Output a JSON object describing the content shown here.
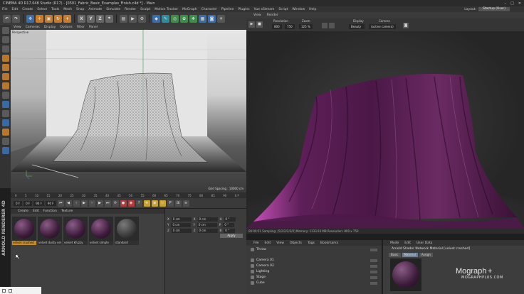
{
  "window": {
    "title": "CINEMA 4D R17.048 Studio (R17) - [0501_Fabric_Basic_Examples_Finish.c4d *] - Main",
    "controls": [
      "–",
      "□",
      "✕"
    ]
  },
  "menubar": {
    "items": [
      "File",
      "Edit",
      "Create",
      "Select",
      "Tools",
      "Mesh",
      "Snap",
      "Animate",
      "Simulate",
      "Render",
      "Sculpt",
      "Motion Tracker",
      "MoGraph",
      "Character",
      "Pipeline",
      "Plugins",
      "Vue xStream",
      "Script",
      "Window",
      "Help"
    ],
    "layout_label": "Layout:",
    "layout_value": "Startup (User)"
  },
  "toolbar": {
    "axis_x": "X",
    "axis_y": "Y",
    "axis_z": "Z"
  },
  "viewport": {
    "menu": [
      "View",
      "Cameras",
      "Display",
      "Options",
      "Filter",
      "Panel"
    ],
    "label": "Perspective",
    "grid_spacing": "Grid Spacing : 10000 cm"
  },
  "timeline": {
    "ticks": [
      "0",
      "5",
      "10",
      "15",
      "20",
      "25",
      "30",
      "35",
      "40",
      "45",
      "50",
      "55",
      "60",
      "65",
      "70",
      "75",
      "80",
      "85",
      "90"
    ],
    "frame_end": "0 F"
  },
  "transport": {
    "start": "0 F",
    "current": "0 F",
    "end": "90 F",
    "end2": "90 F"
  },
  "material_manager": {
    "menu": [
      "Create",
      "Edit",
      "Function",
      "Texture"
    ],
    "materials": [
      {
        "name": "velvet crushed",
        "selected": true,
        "kind": "purple"
      },
      {
        "name": "velvet dusty vel",
        "selected": false,
        "kind": "purple"
      },
      {
        "name": "velvet kfuzzy",
        "selected": false,
        "kind": "purple"
      },
      {
        "name": "velvet simple",
        "selected": false,
        "kind": "purple"
      },
      {
        "name": "standard",
        "selected": false,
        "kind": "gray"
      }
    ]
  },
  "coordinates": {
    "rows": [
      {
        "a": "X",
        "v1": "0 cm",
        "b": "X",
        "v2": "0 cm",
        "c": "H",
        "v3": "0 °"
      },
      {
        "a": "Y",
        "v1": "0 cm",
        "b": "Y",
        "v2": "0 cm",
        "c": "P",
        "v3": "0 °"
      },
      {
        "a": "Z",
        "v1": "0 cm",
        "b": "Z",
        "v2": "0 cm",
        "c": "B",
        "v3": "0 °"
      }
    ],
    "apply": "Apply"
  },
  "render_view": {
    "menu": [
      "View",
      "Render"
    ],
    "resolution_label": "Resolution",
    "resolution_w": "800",
    "resolution_h": "750",
    "zoom_label": "Zoom",
    "zoom_value": "125 %",
    "display_label": "Display",
    "display_value": "Beauty",
    "camera_label": "Camera",
    "camera_value": "(active camera)",
    "status": "00:00:51  Sampling: [5/2/2/2/3/0]  Memory: 1133.93 MB  Resolution: 800 x 750"
  },
  "object_manager": {
    "menu": [
      "File",
      "Edit",
      "View",
      "Objects",
      "Tags",
      "Bookmarks"
    ],
    "objects": [
      "Throw",
      "Camera 01",
      "Camera 02",
      "Lighting",
      "Stage",
      "Cube"
    ]
  },
  "attribute_manager": {
    "menu": [
      "Mode",
      "Edit",
      "User Data"
    ],
    "title": "Arnold Shader Network Material [velvet crushed]",
    "tabs": [
      "Basic",
      "Material",
      "Assign"
    ],
    "selected_tab": "Material"
  },
  "branding": {
    "left": "ARNOLD RENDERER 4D",
    "watermark_big": "Mograph",
    "watermark_plus": "+",
    "watermark_small": "MOGRAPHPLUS.COM"
  },
  "colors": {
    "accent_orange": "#c78a28",
    "velvet_purple": "#5a2457"
  }
}
